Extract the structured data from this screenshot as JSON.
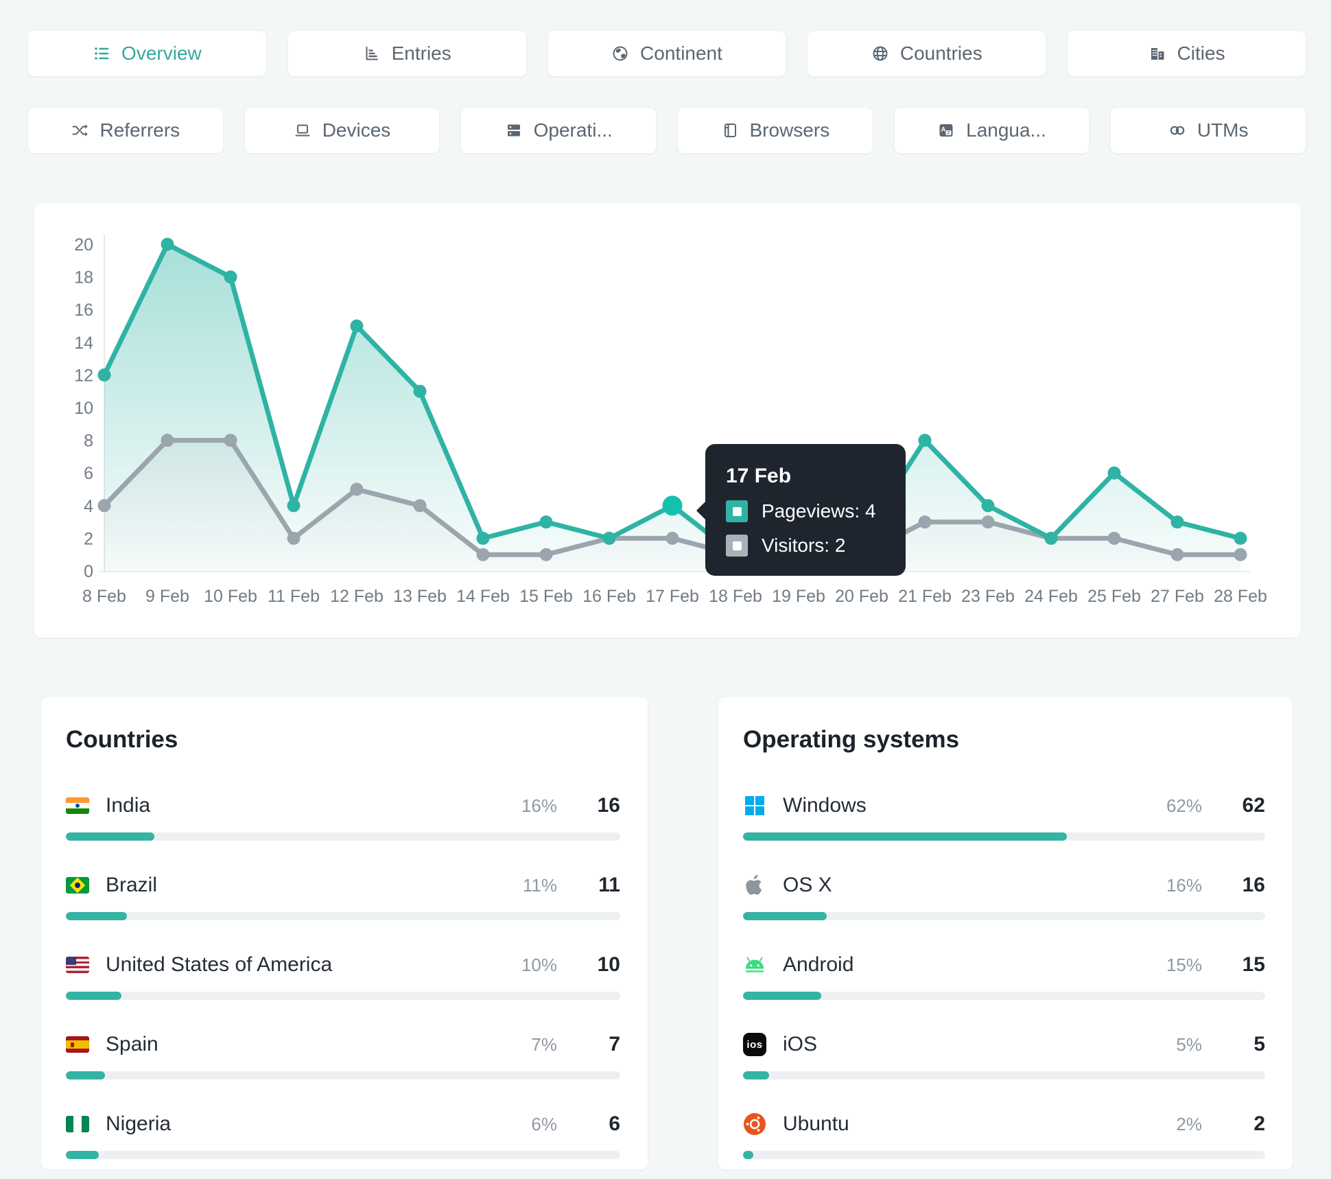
{
  "colors": {
    "accent": "#2eb3a4",
    "accent_active_dot": "#14c1ae",
    "visitors_gray": "#9aa5ad",
    "tooltip_bg": "#1f252e",
    "bar_fill": "#35b3a4",
    "bar_track": "#edf0f2",
    "windows_blue": "#00adef",
    "android_green": "#3ddc84",
    "ubuntu_orange": "#e95420"
  },
  "tabs": [
    {
      "label": "Overview",
      "icon": "list-icon",
      "active": true
    },
    {
      "label": "Entries",
      "icon": "entries-chart-icon",
      "active": false
    },
    {
      "label": "Continent",
      "icon": "continent-globe-icon",
      "active": false
    },
    {
      "label": "Countries",
      "icon": "globe-icon",
      "active": false
    },
    {
      "label": "Cities",
      "icon": "buildings-icon",
      "active": false
    },
    {
      "label": "Referrers",
      "icon": "shuffle-icon",
      "active": false
    },
    {
      "label": "Devices",
      "icon": "laptop-icon",
      "active": false
    },
    {
      "label": "Operati...",
      "icon": "server-stack-icon",
      "active": false
    },
    {
      "label": "Browsers",
      "icon": "browser-window-icon",
      "active": false
    },
    {
      "label": "Langua...",
      "icon": "translate-icon",
      "active": false
    },
    {
      "label": "UTMs",
      "icon": "link-icon",
      "active": false
    }
  ],
  "chart_data": {
    "type": "area",
    "x": [
      "8 Feb",
      "9 Feb",
      "10 Feb",
      "11 Feb",
      "12 Feb",
      "13 Feb",
      "14 Feb",
      "15 Feb",
      "16 Feb",
      "17 Feb",
      "18 Feb",
      "19 Feb",
      "20 Feb",
      "21 Feb",
      "23 Feb",
      "24 Feb",
      "25 Feb",
      "27 Feb",
      "28 Feb"
    ],
    "series": [
      {
        "name": "Pageviews",
        "color": "#2eb3a4",
        "values": [
          12,
          20,
          18,
          4,
          15,
          11,
          2,
          3,
          2,
          4,
          1,
          1,
          2,
          8,
          4,
          2,
          6,
          3,
          2
        ]
      },
      {
        "name": "Visitors",
        "color": "#9aa5ad",
        "values": [
          4,
          8,
          8,
          2,
          5,
          4,
          1,
          1,
          2,
          2,
          1,
          1,
          1,
          3,
          3,
          2,
          2,
          1,
          1
        ]
      }
    ],
    "ylim": [
      0,
      20
    ],
    "yticks": [
      0,
      2,
      4,
      6,
      8,
      10,
      12,
      14,
      16,
      18,
      20
    ],
    "grid": false,
    "legend": "none",
    "active_index": 9
  },
  "tooltip": {
    "title": "17 Feb",
    "rows": [
      {
        "label": "Pageviews: 4",
        "color": "#2eb3a4"
      },
      {
        "label": "Visitors: 2",
        "color": "#a9b2b9"
      }
    ]
  },
  "countries_panel": {
    "title": "Countries",
    "rows": [
      {
        "name": "India",
        "flag": "india-flag-icon",
        "percent": 16,
        "percent_label": "16%",
        "count": "16"
      },
      {
        "name": "Brazil",
        "flag": "brazil-flag-icon",
        "percent": 11,
        "percent_label": "11%",
        "count": "11"
      },
      {
        "name": "United States of America",
        "flag": "usa-flag-icon",
        "percent": 10,
        "percent_label": "10%",
        "count": "10"
      },
      {
        "name": "Spain",
        "flag": "spain-flag-icon",
        "percent": 7,
        "percent_label": "7%",
        "count": "7"
      },
      {
        "name": "Nigeria",
        "flag": "nigeria-flag-icon",
        "percent": 6,
        "percent_label": "6%",
        "count": "6"
      }
    ]
  },
  "os_panel": {
    "title": "Operating systems",
    "rows": [
      {
        "name": "Windows",
        "icon": "windows-logo-icon",
        "percent": 62,
        "percent_label": "62%",
        "count": "62"
      },
      {
        "name": "OS X",
        "icon": "apple-logo-icon",
        "percent": 16,
        "percent_label": "16%",
        "count": "16"
      },
      {
        "name": "Android",
        "icon": "android-logo-icon",
        "percent": 15,
        "percent_label": "15%",
        "count": "15"
      },
      {
        "name": "iOS",
        "icon": "ios-logo-icon",
        "percent": 5,
        "percent_label": "5%",
        "count": "5"
      },
      {
        "name": "Ubuntu",
        "icon": "ubuntu-logo-icon",
        "percent": 2,
        "percent_label": "2%",
        "count": "2"
      }
    ]
  }
}
